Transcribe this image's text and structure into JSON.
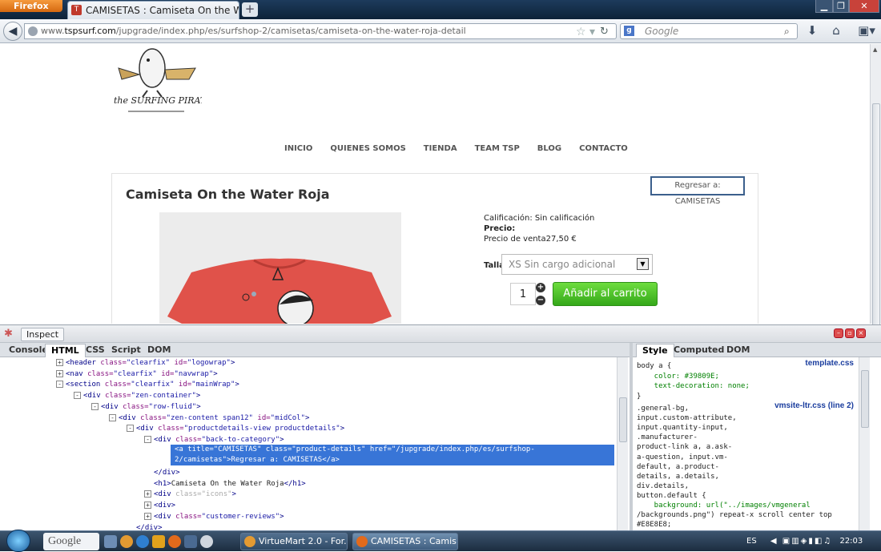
{
  "browser": {
    "app_button": "Firefox",
    "tab_title": "CAMISETAS : Camiseta On the Water Roja",
    "new_tab": "+",
    "url_prefix": "www.",
    "url_host": "tspsurf.com",
    "url_path": "/jupgrade/index.php/es/surfshop-2/camisetas/camiseta-on-the-water-roja-detail",
    "search_placeholder": "Google"
  },
  "site": {
    "logo_text": "the SURFING PIRATAS",
    "menu": [
      "INICIO",
      "QUIENES SOMOS",
      "TIENDA",
      "TEAM TSP",
      "BLOG",
      "CONTACTO"
    ],
    "back_link": "Regresar a: CAMISETAS"
  },
  "product": {
    "title": "Camiseta On the Water Roja",
    "rating": "Calificación: Sin calificación",
    "price_label": "Precio:",
    "sale_price": "Precio de venta27,50 €",
    "size_label": "Talla",
    "size_selected": "XS Sin cargo adicional",
    "quantity": "1",
    "add_to_cart": "Añadir al carrito",
    "shirt_color": "#e0524a"
  },
  "firebug": {
    "inspect_label": "Inspect",
    "tabs": [
      "Console",
      "HTML",
      "CSS",
      "Script",
      "DOM"
    ],
    "active_tab": "HTML",
    "side_tabs": [
      "Style",
      "Computed",
      "DOM"
    ],
    "active_side_tab": "Style",
    "html_lines": [
      {
        "toggle": "+",
        "parts": [
          [
            "t",
            "<header "
          ],
          [
            "a",
            "class="
          ],
          [
            "v",
            "\"clearfix\" "
          ],
          [
            "a",
            "id="
          ],
          [
            "v",
            "\"logowrap\""
          ],
          [
            "t",
            ">"
          ]
        ]
      },
      {
        "toggle": "+",
        "parts": [
          [
            "t",
            "<nav "
          ],
          [
            "a",
            "class="
          ],
          [
            "v",
            "\"clearfix\" "
          ],
          [
            "a",
            "id="
          ],
          [
            "v",
            "\"navwrap\""
          ],
          [
            "t",
            ">"
          ]
        ]
      },
      {
        "toggle": "-",
        "parts": [
          [
            "t",
            "<section "
          ],
          [
            "a",
            "class="
          ],
          [
            "v",
            "\"clearfix\" "
          ],
          [
            "a",
            "id="
          ],
          [
            "v",
            "\"mainWrap\""
          ],
          [
            "t",
            ">"
          ]
        ]
      },
      {
        "toggle": "-",
        "parts": [
          [
            "t",
            "<div "
          ],
          [
            "a",
            "class="
          ],
          [
            "v",
            "\"zen-container\""
          ],
          [
            "t",
            ">"
          ]
        ]
      },
      {
        "toggle": "-",
        "parts": [
          [
            "t",
            "<div "
          ],
          [
            "a",
            "class="
          ],
          [
            "v",
            "\"row-fluid\""
          ],
          [
            "t",
            ">"
          ]
        ]
      },
      {
        "toggle": "-",
        "parts": [
          [
            "t",
            "<div "
          ],
          [
            "a",
            "class="
          ],
          [
            "v",
            "\"zen-content span12\" "
          ],
          [
            "a",
            "id="
          ],
          [
            "v",
            "\"midCol\""
          ],
          [
            "t",
            ">"
          ]
        ]
      },
      {
        "toggle": "-",
        "parts": [
          [
            "t",
            "<div "
          ],
          [
            "a",
            "class="
          ],
          [
            "v",
            "\"productdetails-view productdetails\""
          ],
          [
            "t",
            ">"
          ]
        ]
      },
      {
        "toggle": "-",
        "parts": [
          [
            "t",
            "<div "
          ],
          [
            "a",
            "class="
          ],
          [
            "v",
            "\"back-to-category\""
          ],
          [
            "t",
            ">"
          ]
        ]
      },
      {
        "toggle": "",
        "parts": [
          [
            "t",
            "<a title=\"CAMISETAS\" class=\"product-details\" href=\"/jupgrade/index.php/es/surfshop-"
          ]
        ]
      },
      {
        "toggle": "",
        "parts": [
          [
            "t",
            "2/camisetas\">Regresar a: CAMISETAS</a>"
          ]
        ]
      },
      {
        "toggle": "",
        "parts": [
          [
            "t",
            "</div>"
          ]
        ]
      },
      {
        "toggle": "",
        "parts": [
          [
            "t",
            "<h1>"
          ],
          [
            "x",
            "Camiseta On the Water Roja"
          ],
          [
            "t",
            "</h1>"
          ]
        ]
      },
      {
        "toggle": "+",
        "parts": [
          [
            "t",
            "<div "
          ],
          [
            "a",
            "class="
          ],
          [
            "v",
            "\"icons\""
          ],
          [
            "t",
            ">"
          ]
        ]
      },
      {
        "toggle": "+",
        "parts": [
          [
            "t",
            "<div>"
          ]
        ]
      },
      {
        "toggle": "+",
        "parts": [
          [
            "t",
            "<div "
          ],
          [
            "a",
            "class="
          ],
          [
            "v",
            "\"customer-reviews\""
          ],
          [
            "t",
            ">"
          ]
        ]
      },
      {
        "toggle": "",
        "parts": [
          [
            "t",
            "</div>"
          ]
        ]
      }
    ],
    "style_lines": [
      "body a {",
      "    color: #39809E;",
      "    text-decoration: none;",
      "}",
      ".general-bg,",
      "input.custom-attribute,",
      "input.quantity-input,",
      ".manufacturer-",
      "product-link a, a.ask-",
      "a-question, input.vm-",
      "default, a.product-",
      "details, a.details,",
      "div.details,",
      "button.default {",
      "    background: url(\"../images/vmgeneral",
      "/backgrounds.png\") repeat-x scroll center top",
      "#E8E8E8;"
    ],
    "style_sources": [
      "template.css",
      "vmsite-ltr.css (line 2)"
    ]
  },
  "taskbar": {
    "google_label": "Google",
    "tasks": [
      "VirtueMart 2.0 - For...",
      "CAMISETAS : Camis..."
    ],
    "active_task": 1,
    "language": "ES",
    "clock": "22:03"
  }
}
